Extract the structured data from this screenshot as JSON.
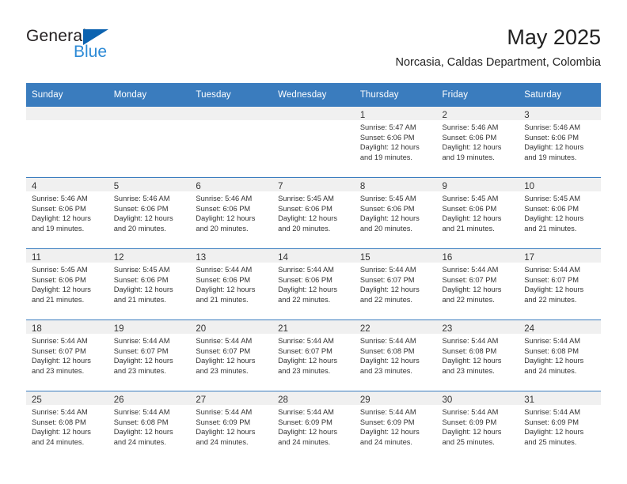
{
  "brand": {
    "name_top": "General",
    "name_bottom": "Blue",
    "triangle_color": "#0c63b0",
    "blue_text_color": "#2c8ad6"
  },
  "header": {
    "title": "May 2025",
    "subtitle": "Norcasia, Caldas Department, Colombia"
  },
  "theme": {
    "header_blue": "#3a7cbe",
    "daynum_band": "#f0f0f0",
    "text": "#333333"
  },
  "calendar": {
    "weekdays": [
      "Sunday",
      "Monday",
      "Tuesday",
      "Wednesday",
      "Thursday",
      "Friday",
      "Saturday"
    ],
    "weeks": [
      [
        {
          "day": "",
          "lines": []
        },
        {
          "day": "",
          "lines": []
        },
        {
          "day": "",
          "lines": []
        },
        {
          "day": "",
          "lines": []
        },
        {
          "day": "1",
          "lines": [
            "Sunrise: 5:47 AM",
            "Sunset: 6:06 PM",
            "Daylight: 12 hours",
            "and 19 minutes."
          ]
        },
        {
          "day": "2",
          "lines": [
            "Sunrise: 5:46 AM",
            "Sunset: 6:06 PM",
            "Daylight: 12 hours",
            "and 19 minutes."
          ]
        },
        {
          "day": "3",
          "lines": [
            "Sunrise: 5:46 AM",
            "Sunset: 6:06 PM",
            "Daylight: 12 hours",
            "and 19 minutes."
          ]
        }
      ],
      [
        {
          "day": "4",
          "lines": [
            "Sunrise: 5:46 AM",
            "Sunset: 6:06 PM",
            "Daylight: 12 hours",
            "and 19 minutes."
          ]
        },
        {
          "day": "5",
          "lines": [
            "Sunrise: 5:46 AM",
            "Sunset: 6:06 PM",
            "Daylight: 12 hours",
            "and 20 minutes."
          ]
        },
        {
          "day": "6",
          "lines": [
            "Sunrise: 5:46 AM",
            "Sunset: 6:06 PM",
            "Daylight: 12 hours",
            "and 20 minutes."
          ]
        },
        {
          "day": "7",
          "lines": [
            "Sunrise: 5:45 AM",
            "Sunset: 6:06 PM",
            "Daylight: 12 hours",
            "and 20 minutes."
          ]
        },
        {
          "day": "8",
          "lines": [
            "Sunrise: 5:45 AM",
            "Sunset: 6:06 PM",
            "Daylight: 12 hours",
            "and 20 minutes."
          ]
        },
        {
          "day": "9",
          "lines": [
            "Sunrise: 5:45 AM",
            "Sunset: 6:06 PM",
            "Daylight: 12 hours",
            "and 21 minutes."
          ]
        },
        {
          "day": "10",
          "lines": [
            "Sunrise: 5:45 AM",
            "Sunset: 6:06 PM",
            "Daylight: 12 hours",
            "and 21 minutes."
          ]
        }
      ],
      [
        {
          "day": "11",
          "lines": [
            "Sunrise: 5:45 AM",
            "Sunset: 6:06 PM",
            "Daylight: 12 hours",
            "and 21 minutes."
          ]
        },
        {
          "day": "12",
          "lines": [
            "Sunrise: 5:45 AM",
            "Sunset: 6:06 PM",
            "Daylight: 12 hours",
            "and 21 minutes."
          ]
        },
        {
          "day": "13",
          "lines": [
            "Sunrise: 5:44 AM",
            "Sunset: 6:06 PM",
            "Daylight: 12 hours",
            "and 21 minutes."
          ]
        },
        {
          "day": "14",
          "lines": [
            "Sunrise: 5:44 AM",
            "Sunset: 6:06 PM",
            "Daylight: 12 hours",
            "and 22 minutes."
          ]
        },
        {
          "day": "15",
          "lines": [
            "Sunrise: 5:44 AM",
            "Sunset: 6:07 PM",
            "Daylight: 12 hours",
            "and 22 minutes."
          ]
        },
        {
          "day": "16",
          "lines": [
            "Sunrise: 5:44 AM",
            "Sunset: 6:07 PM",
            "Daylight: 12 hours",
            "and 22 minutes."
          ]
        },
        {
          "day": "17",
          "lines": [
            "Sunrise: 5:44 AM",
            "Sunset: 6:07 PM",
            "Daylight: 12 hours",
            "and 22 minutes."
          ]
        }
      ],
      [
        {
          "day": "18",
          "lines": [
            "Sunrise: 5:44 AM",
            "Sunset: 6:07 PM",
            "Daylight: 12 hours",
            "and 23 minutes."
          ]
        },
        {
          "day": "19",
          "lines": [
            "Sunrise: 5:44 AM",
            "Sunset: 6:07 PM",
            "Daylight: 12 hours",
            "and 23 minutes."
          ]
        },
        {
          "day": "20",
          "lines": [
            "Sunrise: 5:44 AM",
            "Sunset: 6:07 PM",
            "Daylight: 12 hours",
            "and 23 minutes."
          ]
        },
        {
          "day": "21",
          "lines": [
            "Sunrise: 5:44 AM",
            "Sunset: 6:07 PM",
            "Daylight: 12 hours",
            "and 23 minutes."
          ]
        },
        {
          "day": "22",
          "lines": [
            "Sunrise: 5:44 AM",
            "Sunset: 6:08 PM",
            "Daylight: 12 hours",
            "and 23 minutes."
          ]
        },
        {
          "day": "23",
          "lines": [
            "Sunrise: 5:44 AM",
            "Sunset: 6:08 PM",
            "Daylight: 12 hours",
            "and 23 minutes."
          ]
        },
        {
          "day": "24",
          "lines": [
            "Sunrise: 5:44 AM",
            "Sunset: 6:08 PM",
            "Daylight: 12 hours",
            "and 24 minutes."
          ]
        }
      ],
      [
        {
          "day": "25",
          "lines": [
            "Sunrise: 5:44 AM",
            "Sunset: 6:08 PM",
            "Daylight: 12 hours",
            "and 24 minutes."
          ]
        },
        {
          "day": "26",
          "lines": [
            "Sunrise: 5:44 AM",
            "Sunset: 6:08 PM",
            "Daylight: 12 hours",
            "and 24 minutes."
          ]
        },
        {
          "day": "27",
          "lines": [
            "Sunrise: 5:44 AM",
            "Sunset: 6:09 PM",
            "Daylight: 12 hours",
            "and 24 minutes."
          ]
        },
        {
          "day": "28",
          "lines": [
            "Sunrise: 5:44 AM",
            "Sunset: 6:09 PM",
            "Daylight: 12 hours",
            "and 24 minutes."
          ]
        },
        {
          "day": "29",
          "lines": [
            "Sunrise: 5:44 AM",
            "Sunset: 6:09 PM",
            "Daylight: 12 hours",
            "and 24 minutes."
          ]
        },
        {
          "day": "30",
          "lines": [
            "Sunrise: 5:44 AM",
            "Sunset: 6:09 PM",
            "Daylight: 12 hours",
            "and 25 minutes."
          ]
        },
        {
          "day": "31",
          "lines": [
            "Sunrise: 5:44 AM",
            "Sunset: 6:09 PM",
            "Daylight: 12 hours",
            "and 25 minutes."
          ]
        }
      ]
    ]
  }
}
